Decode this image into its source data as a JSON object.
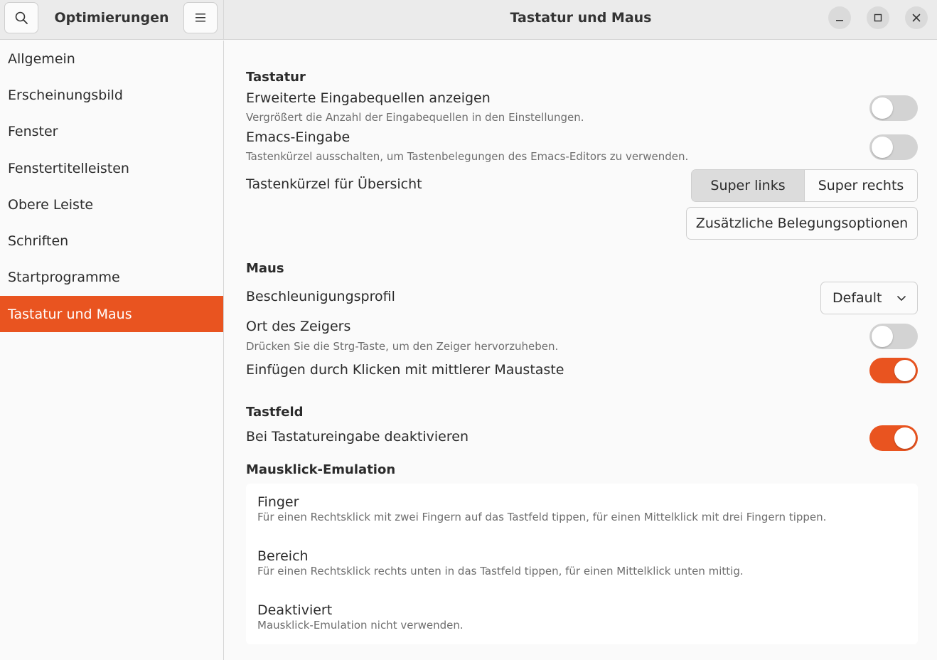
{
  "header": {
    "app_title": "Optimierungen",
    "window_title": "Tastatur und Maus",
    "icons": {
      "search": "search-icon",
      "menu": "hamburger-menu-icon",
      "minimize": "minimize-icon",
      "maximize": "maximize-icon",
      "close": "close-icon"
    }
  },
  "sidebar": {
    "items": [
      {
        "label": "Allgemein",
        "active": false
      },
      {
        "label": "Erscheinungsbild",
        "active": false
      },
      {
        "label": "Fenster",
        "active": false
      },
      {
        "label": "Fenstertitelleisten",
        "active": false
      },
      {
        "label": "Obere Leiste",
        "active": false
      },
      {
        "label": "Schriften",
        "active": false
      },
      {
        "label": "Startprogramme",
        "active": false
      },
      {
        "label": "Tastatur und Maus",
        "active": true
      }
    ]
  },
  "content": {
    "keyboard": {
      "title": "Tastatur",
      "extended_sources": {
        "title": "Erweiterte Eingabequellen anzeigen",
        "subtitle": "Vergrößert die Anzahl der Eingabequellen in den Einstellungen.",
        "enabled": false
      },
      "emacs": {
        "title": "Emacs-Eingabe",
        "subtitle": "Tastenkürzel ausschalten, um Tastenbelegungen des Emacs-Editors zu verwenden.",
        "enabled": false
      },
      "overview_shortcut": {
        "title": "Tastenkürzel für Übersicht",
        "options": [
          "Super links",
          "Super rechts"
        ],
        "selected": "Super links"
      },
      "extra_layout_button": "Zusätzliche Belegungsoptionen"
    },
    "mouse": {
      "title": "Maus",
      "accel_profile": {
        "title": "Beschleunigungsprofil",
        "value": "Default"
      },
      "pointer_location": {
        "title": "Ort des Zeigers",
        "subtitle": "Drücken Sie die Strg-Taste, um den Zeiger hervorzuheben.",
        "enabled": false
      },
      "middle_click_paste": {
        "title": "Einfügen durch Klicken mit mittlerer Maustaste",
        "enabled": true
      }
    },
    "touchpad": {
      "title": "Tastfeld",
      "disable_while_typing": {
        "title": "Bei Tastatureingabe deaktivieren",
        "enabled": true
      }
    },
    "click_emulation": {
      "title": "Mausklick-Emulation",
      "options": [
        {
          "title": "Finger",
          "description": "Für einen Rechtsklick mit zwei Fingern auf das Tastfeld tippen, für einen Mittelklick mit drei Fingern tippen."
        },
        {
          "title": "Bereich",
          "description": "Für einen Rechtsklick rechts unten in das Tastfeld tippen, für einen Mittelklick unten mittig."
        },
        {
          "title": "Deaktiviert",
          "description": "Mausklick-Emulation nicht verwenden."
        }
      ]
    }
  },
  "colors": {
    "accent": "#e95420",
    "switch_off": "#d3d3d3",
    "header_bg": "#ebebeb"
  }
}
